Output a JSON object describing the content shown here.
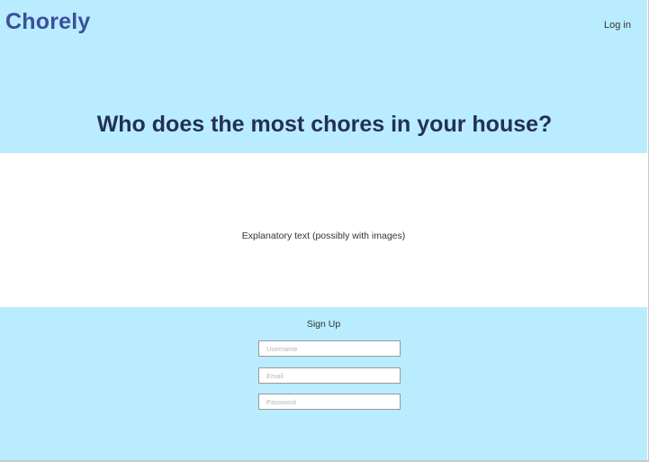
{
  "header": {
    "logo": "Chorely",
    "login_label": "Log in"
  },
  "hero": {
    "headline": "Who does the most chores in your house?"
  },
  "explanation": {
    "text": "Explanatory text (possibly with images)"
  },
  "signup": {
    "title": "Sign Up",
    "username_placeholder": "Username",
    "email_placeholder": "Email",
    "password_placeholder": "Password"
  },
  "colors": {
    "section_background": "#b9ecff",
    "logo": "#3b4f9a",
    "headline": "#243054"
  }
}
